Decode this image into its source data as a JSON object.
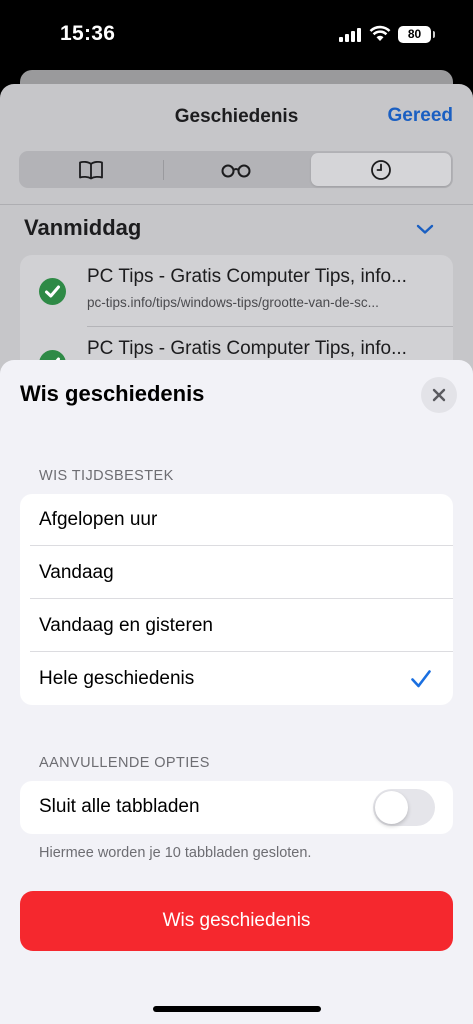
{
  "status_bar": {
    "time": "15:36",
    "battery": "80"
  },
  "history_panel": {
    "title": "Geschiedenis",
    "done_label": "Gereed",
    "section_heading": "Vanmiddag",
    "items": [
      {
        "title": "PC Tips - Gratis Computer Tips, info...",
        "url": "pc-tips.info/tips/windows-tips/grootte-van-de-sc..."
      },
      {
        "title": "PC Tips - Gratis Computer Tips, info..."
      }
    ]
  },
  "clear_history": {
    "title": "Wis geschiedenis",
    "timeframe_heading": "WIS TIJDSBESTEK",
    "timeframe_options": [
      {
        "label": "Afgelopen uur",
        "selected": false
      },
      {
        "label": "Vandaag",
        "selected": false
      },
      {
        "label": "Vandaag en gisteren",
        "selected": false
      },
      {
        "label": "Hele geschiedenis",
        "selected": true
      }
    ],
    "extra_heading": "AANVULLENDE OPTIES",
    "close_tabs_label": "Sluit alle tabbladen",
    "close_tabs_on": false,
    "footnote": "Hiermee worden je 10 tabbladen gesloten.",
    "button_label": "Wis geschiedenis"
  },
  "colors": {
    "accent_blue": "#1a6fe0",
    "destructive_red": "#f5282e",
    "success_green": "#2e8a46"
  }
}
